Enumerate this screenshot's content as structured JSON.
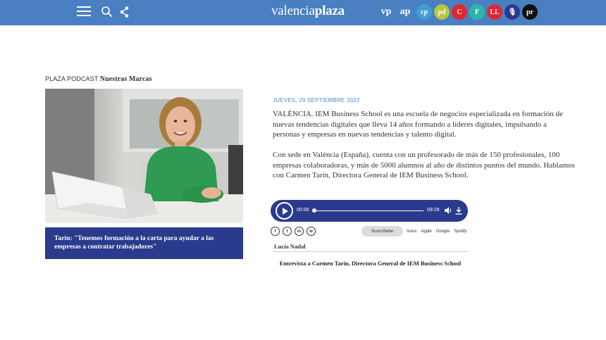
{
  "header": {
    "logo_light": "valencia",
    "logo_bold": "plaza",
    "brand_color": "#4a7fc1",
    "brands": [
      {
        "name": "vp-brand",
        "text": "vp",
        "bg": "transparent",
        "fg": "#ffffff",
        "style": "txt"
      },
      {
        "name": "ap-brand",
        "text": "ap",
        "bg": "transparent",
        "fg": "#ffffff",
        "style": "txt"
      },
      {
        "name": "cp-brand",
        "text": "cp",
        "bg": "#3fa0d8",
        "fg": "#ffffff",
        "style": "circ"
      },
      {
        "name": "pd-brand",
        "text": "pd",
        "bg": "#b5c93a",
        "fg": "#ffffff",
        "style": "circ"
      },
      {
        "name": "c-brand",
        "text": "C",
        "bg": "#e3262d",
        "fg": "#ffffff",
        "style": "circ"
      },
      {
        "name": "f-brand",
        "text": "F",
        "bg": "#2cb5a9",
        "fg": "#ffffff",
        "style": "circ"
      },
      {
        "name": "ll-brand",
        "text": "LL",
        "bg": "#e3262d",
        "fg": "#ffffff",
        "style": "circ"
      },
      {
        "name": "mic-brand",
        "text": "🎙",
        "bg": "#2b3a8f",
        "fg": "#ffffff",
        "style": "circ"
      },
      {
        "name": "pr-brand",
        "text": "pr",
        "bg": "#111111",
        "fg": "#ffffff",
        "style": "circ"
      }
    ],
    "icons": [
      "hamburger-icon",
      "search-icon",
      "share-icon"
    ]
  },
  "section": {
    "label": "PLAZA PODCAST",
    "brand": "Nuestras Marcas"
  },
  "featured": {
    "caption": "Tarín: \"Tenemos formación a la carta para ayudar a las empresas a contratar trabajadores\"",
    "caption_bg": "#2a3a8c"
  },
  "article": {
    "date": "JUEVES, 29 SEPTIEMBRE 2022",
    "paragraph_1": "VALÈNCIA. IEM Business School es una escuela de negocios especializada en formación de nuevas tendencias digitales que lleva 14 años formando a líderes digitales, impulsando a personas y empresas en nuevas tendencias y talento digital.",
    "paragraph_2": "Con sede en València (España), cuenta con un profesorado de más de 150 profesionales, 100 empresas colaboradoras, y más de 5000 alumnos al año de distintos puntos del mundo. Hablamos con Carmen Tarín, Directora General de IEM Business School."
  },
  "player": {
    "current_time": "00:00",
    "duration": "09:28",
    "progress": 0,
    "bg": "#2b3a8f"
  },
  "share": {
    "icons": [
      "facebook-icon",
      "twitter-icon",
      "linkedin-icon",
      "whatsapp-icon"
    ],
    "subscribe_label": "Suscríbete",
    "platforms": [
      "Ivoox",
      "Apple",
      "Google",
      "Spotify"
    ]
  },
  "episode": {
    "author": "Lucía Nadal",
    "title": "Entrevista a Carmen Tarín, Directora General de IEM Business School"
  }
}
